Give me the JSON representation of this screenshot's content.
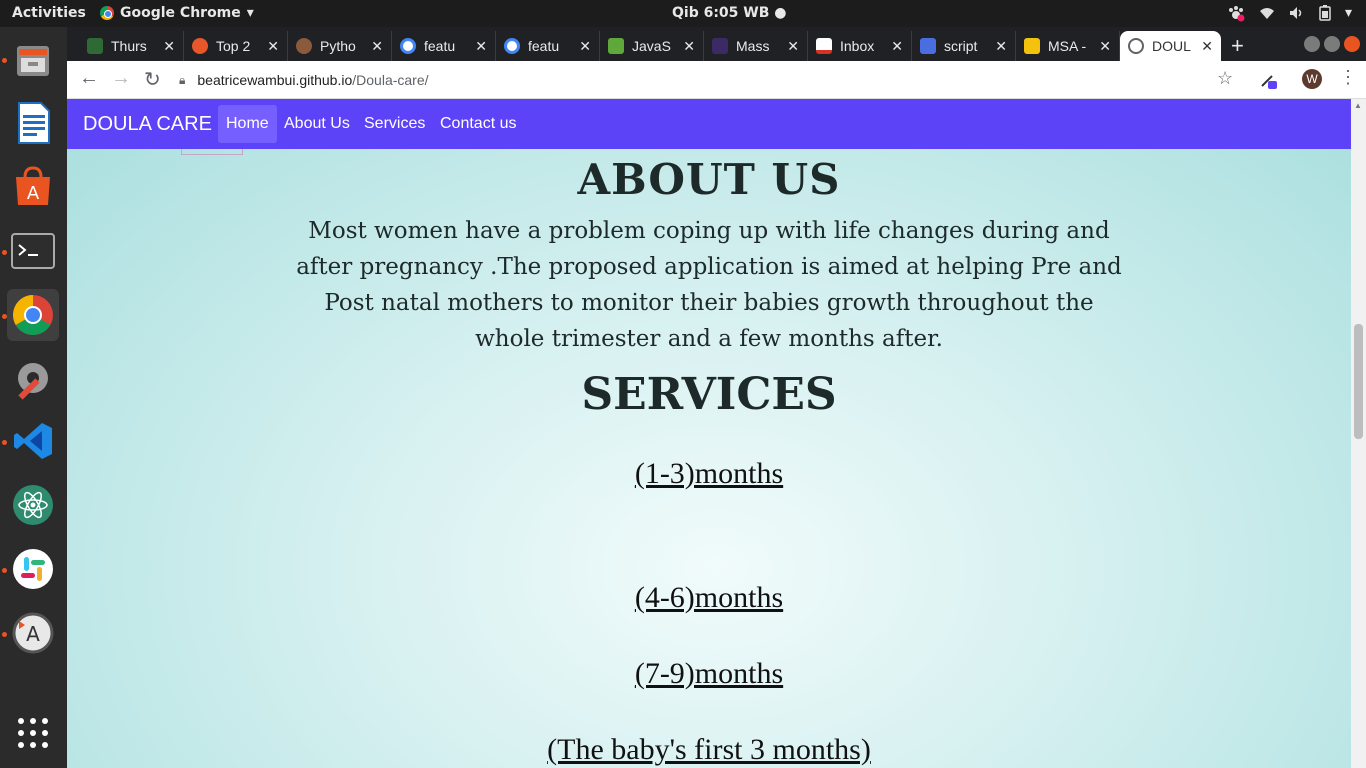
{
  "os": {
    "activities": "Activities",
    "app_name": "Google Chrome",
    "clock": "Qib  6:05 WB"
  },
  "dock": {
    "items": [
      {
        "name": "files-icon"
      },
      {
        "name": "writer-icon"
      },
      {
        "name": "software-center-icon"
      },
      {
        "name": "terminal-icon"
      },
      {
        "name": "chrome-icon"
      },
      {
        "name": "settings-icon"
      },
      {
        "name": "vscode-icon"
      },
      {
        "name": "atom-icon"
      },
      {
        "name": "slack-icon"
      },
      {
        "name": "updater-icon"
      },
      {
        "name": "app-grid-icon"
      }
    ]
  },
  "browser": {
    "tabs": [
      {
        "label": "Thurs",
        "color": "#2e6b34"
      },
      {
        "label": "Top 2",
        "color": "#e8562a"
      },
      {
        "label": "Pytho",
        "color": "#8b5a3c"
      },
      {
        "label": "featu",
        "color": "#4285f4"
      },
      {
        "label": "featu",
        "color": "#4285f4"
      },
      {
        "label": "JavaS",
        "color": "#5fa93a"
      },
      {
        "label": "Mass",
        "color": "#3b2a66"
      },
      {
        "label": "Inbox",
        "color": "#d93025"
      },
      {
        "label": "script",
        "color": "#4a6ee0"
      },
      {
        "label": "MSA -",
        "color": "#f4c20d"
      },
      {
        "label": "DOUL",
        "color": "#5f6368"
      }
    ],
    "new_tab": "+",
    "url_host": "beatricewambui.github.io",
    "url_path": "/Doula-care/",
    "avatar_letter": "W"
  },
  "site": {
    "brand": "DOULA CARE",
    "nav": [
      {
        "label": "Home",
        "active": true
      },
      {
        "label": "About Us",
        "active": false
      },
      {
        "label": "Services",
        "active": false
      },
      {
        "label": "Contact us",
        "active": false
      }
    ],
    "about_title": "ABOUT US",
    "about_text": "Most women have a problem coping up with life changes during and after pregnancy .The proposed application is aimed at helping Pre and Post natal mothers to monitor their babies growth throughout the whole trimester and a few months after.",
    "services_title": "SERVICES",
    "services": [
      {
        "label": "(1-3)months"
      },
      {
        "label": "(4-6)months"
      },
      {
        "label": "(7-9)months"
      },
      {
        "label": "(The baby's first 3 months)"
      }
    ]
  }
}
